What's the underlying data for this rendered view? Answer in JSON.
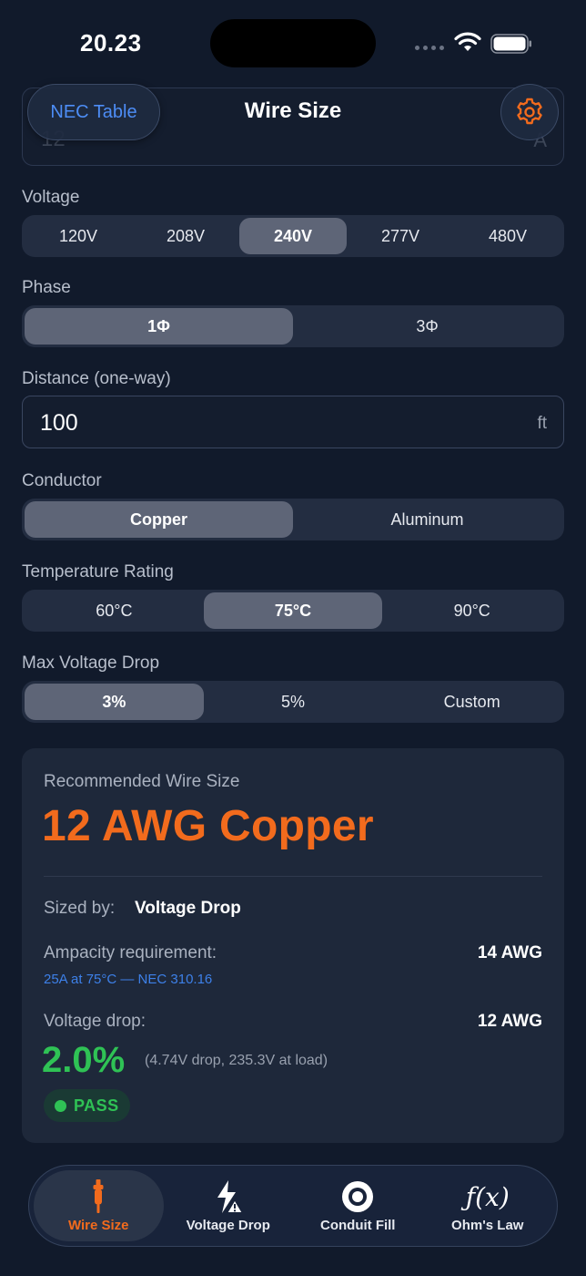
{
  "status_bar": {
    "time": "20.23"
  },
  "header": {
    "nec_button_label": "NEC Table",
    "title": "Wire Size",
    "partial_field_value": "12",
    "partial_field_unit": "A"
  },
  "voltage": {
    "label": "Voltage",
    "options": [
      "120V",
      "208V",
      "240V",
      "277V",
      "480V"
    ],
    "selected": "240V"
  },
  "phase": {
    "label": "Phase",
    "options": [
      "1Φ",
      "3Φ"
    ],
    "selected": "1Φ"
  },
  "distance": {
    "label": "Distance (one-way)",
    "value": "100",
    "unit": "ft"
  },
  "conductor": {
    "label": "Conductor",
    "options": [
      "Copper",
      "Aluminum"
    ],
    "selected": "Copper"
  },
  "temperature": {
    "label": "Temperature Rating",
    "options": [
      "60°C",
      "75°C",
      "90°C"
    ],
    "selected": "75°C"
  },
  "max_drop": {
    "label": "Max Voltage Drop",
    "options": [
      "3%",
      "5%",
      "Custom"
    ],
    "selected": "3%"
  },
  "result": {
    "label": "Recommended Wire Size",
    "wire": "12 AWG Copper",
    "sized_by_label": "Sized by:",
    "sized_by_value": "Voltage Drop",
    "ampacity_label": "Ampacity requirement:",
    "ampacity_value": "14 AWG",
    "ampacity_note": "25A at 75°C — NEC 310.16",
    "vdrop_label": "Voltage drop:",
    "vdrop_value": "12 AWG",
    "vdrop_percent": "2.0%",
    "vdrop_detail": "(4.74V drop, 235.3V at load)",
    "status": "PASS"
  },
  "tabs": [
    {
      "label": "Wire Size",
      "icon": "plug-icon"
    },
    {
      "label": "Voltage Drop",
      "icon": "lightning-warning-icon"
    },
    {
      "label": "Conduit Fill",
      "icon": "conduit-circle-icon"
    },
    {
      "label": "Ohm's Law",
      "icon": "function-icon"
    }
  ],
  "colors": {
    "accent": "#f26b1d",
    "link": "#3d80e8",
    "pass": "#2fc255",
    "background": "#111a2b",
    "card": "#1e283a"
  }
}
